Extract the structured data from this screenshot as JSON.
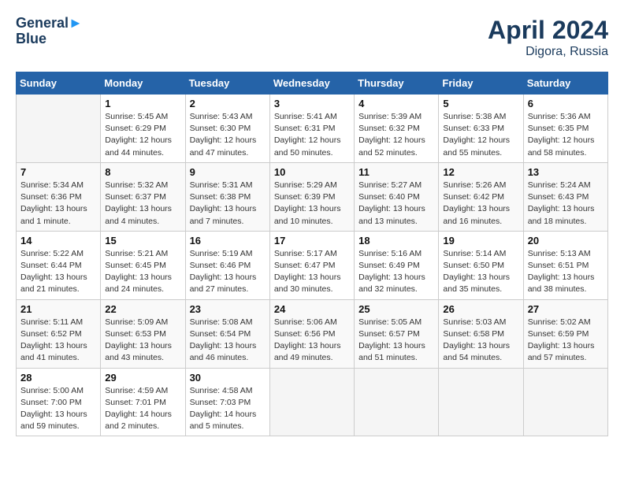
{
  "header": {
    "logo_line1": "General",
    "logo_line2": "Blue",
    "month_year": "April 2024",
    "location": "Digora, Russia"
  },
  "calendar": {
    "days_of_week": [
      "Sunday",
      "Monday",
      "Tuesday",
      "Wednesday",
      "Thursday",
      "Friday",
      "Saturday"
    ],
    "weeks": [
      [
        {
          "day": "",
          "info": ""
        },
        {
          "day": "1",
          "info": "Sunrise: 5:45 AM\nSunset: 6:29 PM\nDaylight: 12 hours\nand 44 minutes."
        },
        {
          "day": "2",
          "info": "Sunrise: 5:43 AM\nSunset: 6:30 PM\nDaylight: 12 hours\nand 47 minutes."
        },
        {
          "day": "3",
          "info": "Sunrise: 5:41 AM\nSunset: 6:31 PM\nDaylight: 12 hours\nand 50 minutes."
        },
        {
          "day": "4",
          "info": "Sunrise: 5:39 AM\nSunset: 6:32 PM\nDaylight: 12 hours\nand 52 minutes."
        },
        {
          "day": "5",
          "info": "Sunrise: 5:38 AM\nSunset: 6:33 PM\nDaylight: 12 hours\nand 55 minutes."
        },
        {
          "day": "6",
          "info": "Sunrise: 5:36 AM\nSunset: 6:35 PM\nDaylight: 12 hours\nand 58 minutes."
        }
      ],
      [
        {
          "day": "7",
          "info": "Sunrise: 5:34 AM\nSunset: 6:36 PM\nDaylight: 13 hours\nand 1 minute."
        },
        {
          "day": "8",
          "info": "Sunrise: 5:32 AM\nSunset: 6:37 PM\nDaylight: 13 hours\nand 4 minutes."
        },
        {
          "day": "9",
          "info": "Sunrise: 5:31 AM\nSunset: 6:38 PM\nDaylight: 13 hours\nand 7 minutes."
        },
        {
          "day": "10",
          "info": "Sunrise: 5:29 AM\nSunset: 6:39 PM\nDaylight: 13 hours\nand 10 minutes."
        },
        {
          "day": "11",
          "info": "Sunrise: 5:27 AM\nSunset: 6:40 PM\nDaylight: 13 hours\nand 13 minutes."
        },
        {
          "day": "12",
          "info": "Sunrise: 5:26 AM\nSunset: 6:42 PM\nDaylight: 13 hours\nand 16 minutes."
        },
        {
          "day": "13",
          "info": "Sunrise: 5:24 AM\nSunset: 6:43 PM\nDaylight: 13 hours\nand 18 minutes."
        }
      ],
      [
        {
          "day": "14",
          "info": "Sunrise: 5:22 AM\nSunset: 6:44 PM\nDaylight: 13 hours\nand 21 minutes."
        },
        {
          "day": "15",
          "info": "Sunrise: 5:21 AM\nSunset: 6:45 PM\nDaylight: 13 hours\nand 24 minutes."
        },
        {
          "day": "16",
          "info": "Sunrise: 5:19 AM\nSunset: 6:46 PM\nDaylight: 13 hours\nand 27 minutes."
        },
        {
          "day": "17",
          "info": "Sunrise: 5:17 AM\nSunset: 6:47 PM\nDaylight: 13 hours\nand 30 minutes."
        },
        {
          "day": "18",
          "info": "Sunrise: 5:16 AM\nSunset: 6:49 PM\nDaylight: 13 hours\nand 32 minutes."
        },
        {
          "day": "19",
          "info": "Sunrise: 5:14 AM\nSunset: 6:50 PM\nDaylight: 13 hours\nand 35 minutes."
        },
        {
          "day": "20",
          "info": "Sunrise: 5:13 AM\nSunset: 6:51 PM\nDaylight: 13 hours\nand 38 minutes."
        }
      ],
      [
        {
          "day": "21",
          "info": "Sunrise: 5:11 AM\nSunset: 6:52 PM\nDaylight: 13 hours\nand 41 minutes."
        },
        {
          "day": "22",
          "info": "Sunrise: 5:09 AM\nSunset: 6:53 PM\nDaylight: 13 hours\nand 43 minutes."
        },
        {
          "day": "23",
          "info": "Sunrise: 5:08 AM\nSunset: 6:54 PM\nDaylight: 13 hours\nand 46 minutes."
        },
        {
          "day": "24",
          "info": "Sunrise: 5:06 AM\nSunset: 6:56 PM\nDaylight: 13 hours\nand 49 minutes."
        },
        {
          "day": "25",
          "info": "Sunrise: 5:05 AM\nSunset: 6:57 PM\nDaylight: 13 hours\nand 51 minutes."
        },
        {
          "day": "26",
          "info": "Sunrise: 5:03 AM\nSunset: 6:58 PM\nDaylight: 13 hours\nand 54 minutes."
        },
        {
          "day": "27",
          "info": "Sunrise: 5:02 AM\nSunset: 6:59 PM\nDaylight: 13 hours\nand 57 minutes."
        }
      ],
      [
        {
          "day": "28",
          "info": "Sunrise: 5:00 AM\nSunset: 7:00 PM\nDaylight: 13 hours\nand 59 minutes."
        },
        {
          "day": "29",
          "info": "Sunrise: 4:59 AM\nSunset: 7:01 PM\nDaylight: 14 hours\nand 2 minutes."
        },
        {
          "day": "30",
          "info": "Sunrise: 4:58 AM\nSunset: 7:03 PM\nDaylight: 14 hours\nand 5 minutes."
        },
        {
          "day": "",
          "info": ""
        },
        {
          "day": "",
          "info": ""
        },
        {
          "day": "",
          "info": ""
        },
        {
          "day": "",
          "info": ""
        }
      ]
    ]
  }
}
